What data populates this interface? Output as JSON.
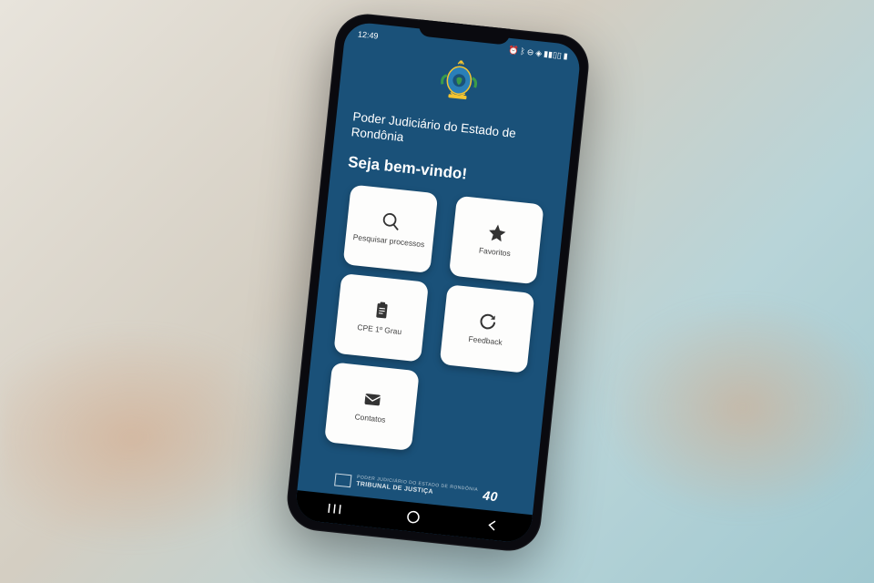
{
  "status_bar": {
    "time": "12:49"
  },
  "header": {
    "org_title": "Poder Judiciário do Estado de Rondônia",
    "welcome": "Seja bem-vindo!"
  },
  "tiles": [
    {
      "label": "Pesquisar processos",
      "icon": "search"
    },
    {
      "label": "Favoritos",
      "icon": "star"
    },
    {
      "label": "CPE 1º Grau",
      "icon": "clipboard"
    },
    {
      "label": "Feedback",
      "icon": "refresh"
    },
    {
      "label": "Contatos",
      "icon": "mail"
    }
  ],
  "footer": {
    "small": "PODER JUDICIÁRIO DO ESTADO DE RONDÔNIA",
    "main": "TRIBUNAL DE JUSTIÇA",
    "badge": "40"
  }
}
